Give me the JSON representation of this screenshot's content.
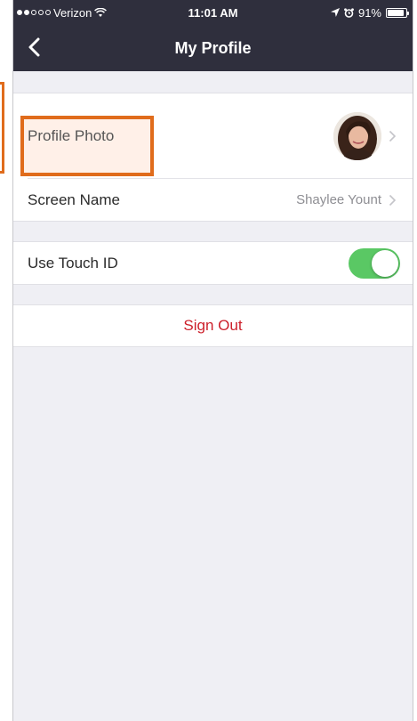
{
  "status_bar": {
    "carrier": "Verizon",
    "time": "11:01 AM",
    "battery": "91%",
    "battery_level": 0.91
  },
  "nav": {
    "title": "My Profile"
  },
  "profile": {
    "photo_label": "Profile Photo",
    "screen_name_label": "Screen Name",
    "screen_name_value": "Shaylee Yount",
    "touch_id_label": "Use Touch ID",
    "touch_id_enabled": true
  },
  "actions": {
    "sign_out": "Sign Out"
  },
  "colors": {
    "nav_bg": "#2f2f3d",
    "toggle_on": "#5ac864",
    "sign_out": "#cc1f2a",
    "highlight": "#e06c1c"
  }
}
